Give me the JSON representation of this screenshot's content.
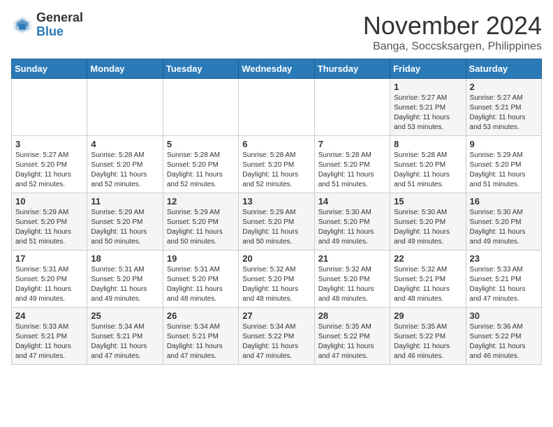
{
  "header": {
    "logo_general": "General",
    "logo_blue": "Blue",
    "month_title": "November 2024",
    "location": "Banga, Soccsksargen, Philippines"
  },
  "weekdays": [
    "Sunday",
    "Monday",
    "Tuesday",
    "Wednesday",
    "Thursday",
    "Friday",
    "Saturday"
  ],
  "weeks": [
    [
      {
        "day": "",
        "info": ""
      },
      {
        "day": "",
        "info": ""
      },
      {
        "day": "",
        "info": ""
      },
      {
        "day": "",
        "info": ""
      },
      {
        "day": "",
        "info": ""
      },
      {
        "day": "1",
        "info": "Sunrise: 5:27 AM\nSunset: 5:21 PM\nDaylight: 11 hours and 53 minutes."
      },
      {
        "day": "2",
        "info": "Sunrise: 5:27 AM\nSunset: 5:21 PM\nDaylight: 11 hours and 53 minutes."
      }
    ],
    [
      {
        "day": "3",
        "info": "Sunrise: 5:27 AM\nSunset: 5:20 PM\nDaylight: 11 hours and 52 minutes."
      },
      {
        "day": "4",
        "info": "Sunrise: 5:28 AM\nSunset: 5:20 PM\nDaylight: 11 hours and 52 minutes."
      },
      {
        "day": "5",
        "info": "Sunrise: 5:28 AM\nSunset: 5:20 PM\nDaylight: 11 hours and 52 minutes."
      },
      {
        "day": "6",
        "info": "Sunrise: 5:28 AM\nSunset: 5:20 PM\nDaylight: 11 hours and 52 minutes."
      },
      {
        "day": "7",
        "info": "Sunrise: 5:28 AM\nSunset: 5:20 PM\nDaylight: 11 hours and 51 minutes."
      },
      {
        "day": "8",
        "info": "Sunrise: 5:28 AM\nSunset: 5:20 PM\nDaylight: 11 hours and 51 minutes."
      },
      {
        "day": "9",
        "info": "Sunrise: 5:29 AM\nSunset: 5:20 PM\nDaylight: 11 hours and 51 minutes."
      }
    ],
    [
      {
        "day": "10",
        "info": "Sunrise: 5:29 AM\nSunset: 5:20 PM\nDaylight: 11 hours and 51 minutes."
      },
      {
        "day": "11",
        "info": "Sunrise: 5:29 AM\nSunset: 5:20 PM\nDaylight: 11 hours and 50 minutes."
      },
      {
        "day": "12",
        "info": "Sunrise: 5:29 AM\nSunset: 5:20 PM\nDaylight: 11 hours and 50 minutes."
      },
      {
        "day": "13",
        "info": "Sunrise: 5:29 AM\nSunset: 5:20 PM\nDaylight: 11 hours and 50 minutes."
      },
      {
        "day": "14",
        "info": "Sunrise: 5:30 AM\nSunset: 5:20 PM\nDaylight: 11 hours and 49 minutes."
      },
      {
        "day": "15",
        "info": "Sunrise: 5:30 AM\nSunset: 5:20 PM\nDaylight: 11 hours and 49 minutes."
      },
      {
        "day": "16",
        "info": "Sunrise: 5:30 AM\nSunset: 5:20 PM\nDaylight: 11 hours and 49 minutes."
      }
    ],
    [
      {
        "day": "17",
        "info": "Sunrise: 5:31 AM\nSunset: 5:20 PM\nDaylight: 11 hours and 49 minutes."
      },
      {
        "day": "18",
        "info": "Sunrise: 5:31 AM\nSunset: 5:20 PM\nDaylight: 11 hours and 49 minutes."
      },
      {
        "day": "19",
        "info": "Sunrise: 5:31 AM\nSunset: 5:20 PM\nDaylight: 11 hours and 48 minutes."
      },
      {
        "day": "20",
        "info": "Sunrise: 5:32 AM\nSunset: 5:20 PM\nDaylight: 11 hours and 48 minutes."
      },
      {
        "day": "21",
        "info": "Sunrise: 5:32 AM\nSunset: 5:20 PM\nDaylight: 11 hours and 48 minutes."
      },
      {
        "day": "22",
        "info": "Sunrise: 5:32 AM\nSunset: 5:21 PM\nDaylight: 11 hours and 48 minutes."
      },
      {
        "day": "23",
        "info": "Sunrise: 5:33 AM\nSunset: 5:21 PM\nDaylight: 11 hours and 47 minutes."
      }
    ],
    [
      {
        "day": "24",
        "info": "Sunrise: 5:33 AM\nSunset: 5:21 PM\nDaylight: 11 hours and 47 minutes."
      },
      {
        "day": "25",
        "info": "Sunrise: 5:34 AM\nSunset: 5:21 PM\nDaylight: 11 hours and 47 minutes."
      },
      {
        "day": "26",
        "info": "Sunrise: 5:34 AM\nSunset: 5:21 PM\nDaylight: 11 hours and 47 minutes."
      },
      {
        "day": "27",
        "info": "Sunrise: 5:34 AM\nSunset: 5:22 PM\nDaylight: 11 hours and 47 minutes."
      },
      {
        "day": "28",
        "info": "Sunrise: 5:35 AM\nSunset: 5:22 PM\nDaylight: 11 hours and 47 minutes."
      },
      {
        "day": "29",
        "info": "Sunrise: 5:35 AM\nSunset: 5:22 PM\nDaylight: 11 hours and 46 minutes."
      },
      {
        "day": "30",
        "info": "Sunrise: 5:36 AM\nSunset: 5:22 PM\nDaylight: 11 hours and 46 minutes."
      }
    ]
  ]
}
